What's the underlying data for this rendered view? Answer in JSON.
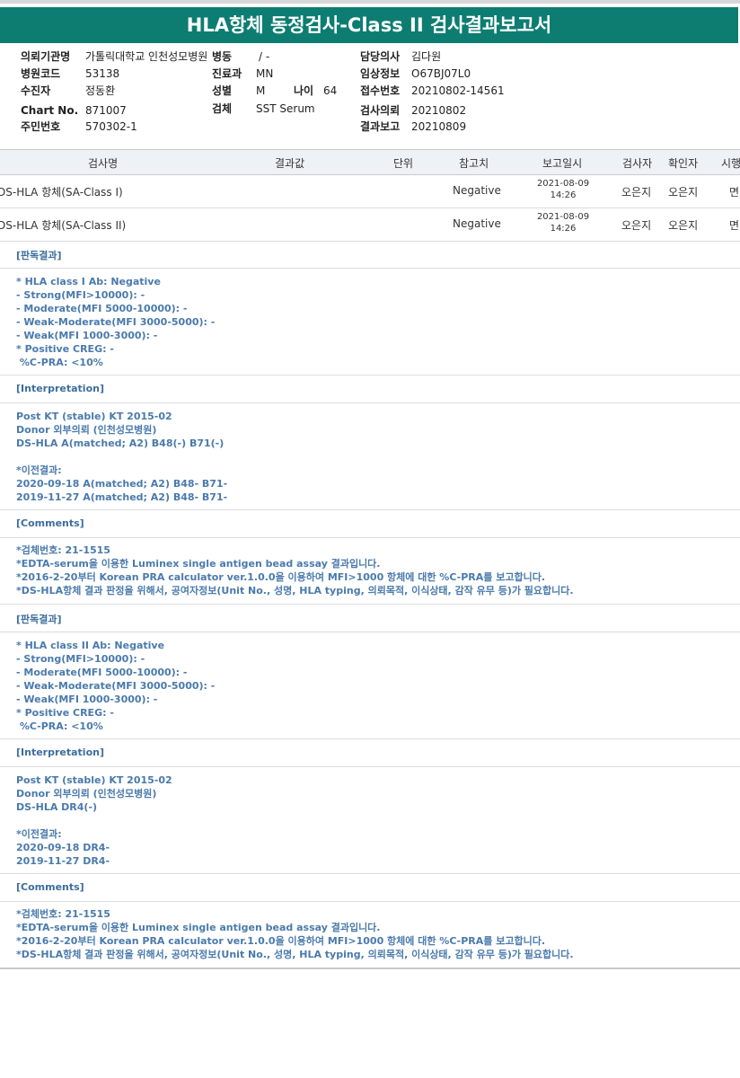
{
  "title": "HLA항체 동정검사-Class II 검사결과보고서",
  "info": {
    "hospital_label": "의뢰기관명",
    "hospital_value": "가톨릭대학교 인천성모병원",
    "ward_label": "병동",
    "ward_value": "/ -",
    "doctor_label": "담당의사",
    "doctor_value": "김다원",
    "hospcode_label": "병원코드",
    "hospcode_value": "53138",
    "dept_label": "진료과",
    "dept_value": "MN",
    "clinical_label": "임상정보",
    "clinical_value": "O67BJ07L0",
    "patient_label": "수진자",
    "patient_value": "정동환",
    "sex_label": "성별",
    "sex_value": "M",
    "age_label": "나이",
    "age_value": "64",
    "receipt_label": "접수번호",
    "receipt_value": "20210802-14561",
    "chart_label": "Chart No.",
    "chart_value": "871007",
    "specimen_label": "검체",
    "specimen_value": "SST Serum",
    "request_label": "검사의뢰",
    "request_value": "20210802",
    "rrn_label": "주민번호",
    "rrn_value": "570302-1",
    "report_label": "결과보고",
    "report_value": "20210809"
  },
  "table": {
    "headers": [
      "검사명",
      "결과값",
      "단위",
      "참고치",
      "보고일시",
      "검사자",
      "확인자",
      "시행"
    ],
    "rows": [
      {
        "name": "DS-HLA 항체(SA-Class I)",
        "ref": "Negative",
        "date": "2021-08-09",
        "time": "14:26",
        "tester": "오은지",
        "checker": "오은지",
        "site": "면"
      },
      {
        "name": "DS-HLA 항체(SA-Class II)",
        "ref": "Negative",
        "date": "2021-08-09",
        "time": "14:26",
        "tester": "오은지",
        "checker": "오은지",
        "site": "면"
      }
    ]
  },
  "sections": [
    {
      "heading": "[판독결과]",
      "lines": [
        "* HLA class I Ab: Negative",
        "- Strong(MFI>10000): -",
        "- Moderate(MFI 5000-10000): -",
        "- Weak-Moderate(MFI 3000-5000): -",
        "- Weak(MFI 1000-3000): -",
        "* Positive CREG: -",
        " %C-PRA: <10%"
      ]
    },
    {
      "heading": "[Interpretation]",
      "lines": [
        "Post KT (stable) KT 2015-02",
        "Donor 외부의뢰 (인천성모병원)",
        "DS-HLA A(matched; A2) B48(-) B71(-)",
        "",
        "*이전결과:",
        "2020-09-18 A(matched; A2) B48- B71-",
        "2019-11-27 A(matched; A2) B48- B71-"
      ]
    },
    {
      "heading": "[Comments]",
      "lines": [
        "*검체번호: 21-1515",
        "*EDTA-serum을 이용한 Luminex single antigen bead assay 결과입니다.",
        "*2016-2-20부터 Korean PRA calculator ver.1.0.0을 이용하여 MFI>1000 항체에 대한 %C-PRA를 보고합니다.",
        "*DS-HLA항체 결과 판정을 위해서, 공여자정보(Unit No., 성명, HLA typing, 의뢰목적, 이식상태, 감작 유무 등)가 필요합니다."
      ]
    },
    {
      "heading": "[판독결과]",
      "lines": [
        "* HLA class II Ab: Negative",
        "- Strong(MFI>10000): -",
        "- Moderate(MFI 5000-10000): -",
        "- Weak-Moderate(MFI 3000-5000): -",
        "- Weak(MFI 1000-3000): -",
        "* Positive CREG: -",
        " %C-PRA: <10%"
      ]
    },
    {
      "heading": "[Interpretation]",
      "lines": [
        "Post KT (stable) KT 2015-02",
        "Donor 외부의뢰 (인천성모병원)",
        "DS-HLA DR4(-)",
        "",
        "*이전결과:",
        "2020-09-18 DR4-",
        "2019-11-27 DR4-"
      ]
    },
    {
      "heading": "[Comments]",
      "lines": [
        "*검체번호: 21-1515",
        "*EDTA-serum을 이용한 Luminex single antigen bead assay 결과입니다.",
        "*2016-2-20부터 Korean PRA calculator ver.1.0.0을 이용하여 MFI>1000 항체에 대한 %C-PRA를 보고합니다.",
        "*DS-HLA항체 결과 판정을 위해서, 공여자정보(Unit No., 성명, HLA typing, 의뢰목적, 이식상태, 감작 유무 등)가 필요합니다."
      ]
    }
  ],
  "colors": {
    "title_bg": "#0d7d72",
    "section_text": "#4a7aac"
  }
}
